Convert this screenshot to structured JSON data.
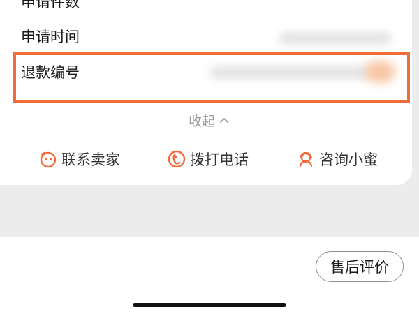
{
  "details": {
    "rows": [
      {
        "label": "申请件数"
      },
      {
        "label": "申请时间"
      },
      {
        "label": "退款编号"
      }
    ],
    "collapse_label": "收起"
  },
  "actions": [
    {
      "label": "联系卖家",
      "icon": "chat-face-icon"
    },
    {
      "label": "拨打电话",
      "icon": "phone-icon"
    },
    {
      "label": "咨询小蜜",
      "icon": "assistant-headset-icon"
    }
  ],
  "footer": {
    "review_button": "售后评价"
  },
  "colors": {
    "accent": "#f26b3a",
    "highlight_border": "#f26b3a",
    "muted_text": "#999999",
    "primary_text": "#1a1a1a"
  }
}
